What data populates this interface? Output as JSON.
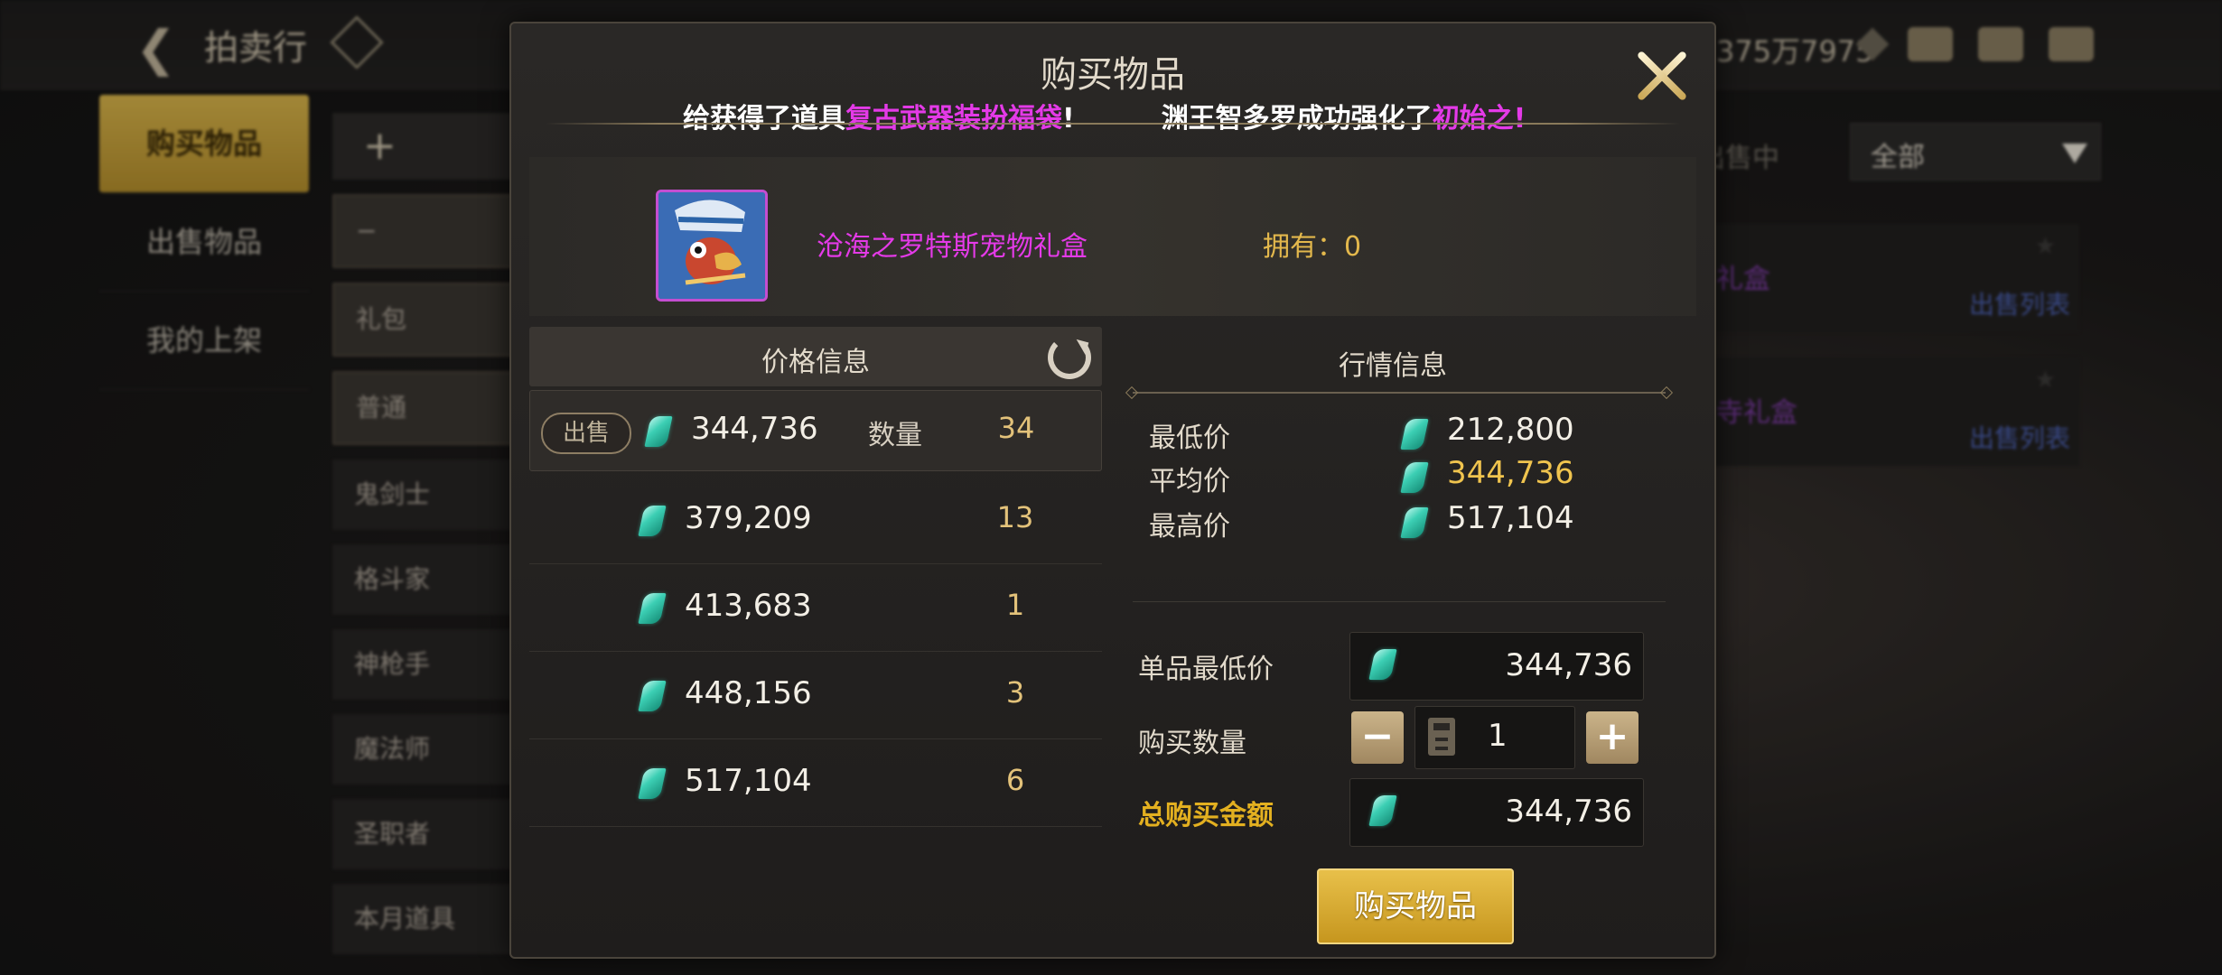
{
  "header": {
    "back_label": "拍卖行",
    "currency_text": "375万7975"
  },
  "sidebar": {
    "items": [
      {
        "label": "购买物品",
        "active": true
      },
      {
        "label": "出售物品",
        "active": false
      },
      {
        "label": "我的上架",
        "active": false
      }
    ]
  },
  "categories": {
    "add_icon": "+",
    "items": [
      "礼包",
      "普通",
      "鬼剑士",
      "格斗家",
      "神枪手",
      "魔法师",
      "圣职者",
      "本月道具"
    ]
  },
  "filter": {
    "label": "出售中",
    "selected": "全部"
  },
  "bg_list": [
    {
      "name": "礼盒",
      "link": "出售列表"
    },
    {
      "name": "寺礼盒",
      "link": "出售列表"
    }
  ],
  "dialog": {
    "title": "购买物品",
    "ticker": {
      "part1_prefix": "给获得了道具",
      "part1_highlight": "复古武器装扮福袋",
      "part1_suffix": "!",
      "part2_prefix": "渊王智多罗成功强化了",
      "part2_highlight": "初始之!"
    },
    "item": {
      "name": "沧海之罗特斯宠物礼盒",
      "own_label": "拥有：0"
    },
    "price_info": {
      "header": "价格信息",
      "sell_badge": "出售",
      "qty_label": "数量",
      "rows": [
        {
          "price": "344,736",
          "qty": "34"
        },
        {
          "price": "379,209",
          "qty": "13"
        },
        {
          "price": "413,683",
          "qty": "1"
        },
        {
          "price": "448,156",
          "qty": "3"
        },
        {
          "price": "517,104",
          "qty": "6"
        }
      ]
    },
    "market_info": {
      "header": "行情信息",
      "min_label": "最低价",
      "min_value": "212,800",
      "avg_label": "平均价",
      "avg_value": "344,736",
      "max_label": "最高价",
      "max_value": "517,104"
    },
    "purchase": {
      "unit_label": "单品最低价",
      "unit_value": "344,736",
      "qty_label": "购买数量",
      "qty_minus": "−",
      "qty_plus": "+",
      "qty_value": "1",
      "total_label": "总购买金额",
      "total_value": "344,736",
      "buy_button": "购买物品"
    },
    "colors": {
      "highlight_magenta": "#e43ae8",
      "gold": "#e3b020",
      "gem": "#3ccfb4"
    },
    "icons": [
      "close-icon",
      "refresh-icon",
      "gem-icon",
      "calculator-icon",
      "minus-icon",
      "plus-icon"
    ]
  }
}
